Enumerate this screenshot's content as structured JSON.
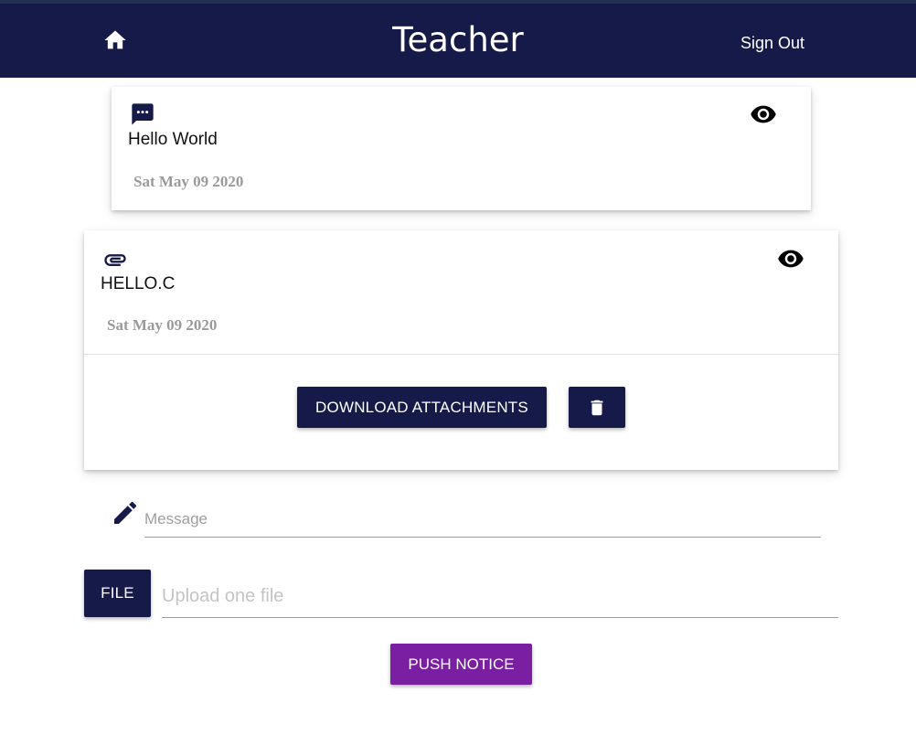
{
  "header": {
    "title": "Teacher",
    "sign_out_label": "Sign Out",
    "home_icon": "home-icon",
    "background": "#161a48"
  },
  "notices": [
    {
      "type_icon": "chat-icon",
      "title": "Hello World",
      "date": "Sat May 09 2020",
      "view_icon": "eye-icon"
    },
    {
      "type_icon": "attachment-icon",
      "title": "HELLO.C",
      "date": "Sat May 09 2020",
      "view_icon": "eye-icon",
      "download_label": "DOWNLOAD ATTACHMENTS",
      "delete_icon": "trash-icon"
    }
  ],
  "compose": {
    "message_placeholder": "Message",
    "message_icon": "pencil-icon",
    "file_button_label": "FILE",
    "upload_placeholder": "Upload one file",
    "push_button_label": "PUSH NOTICE",
    "push_color": "#7b1fa2"
  }
}
